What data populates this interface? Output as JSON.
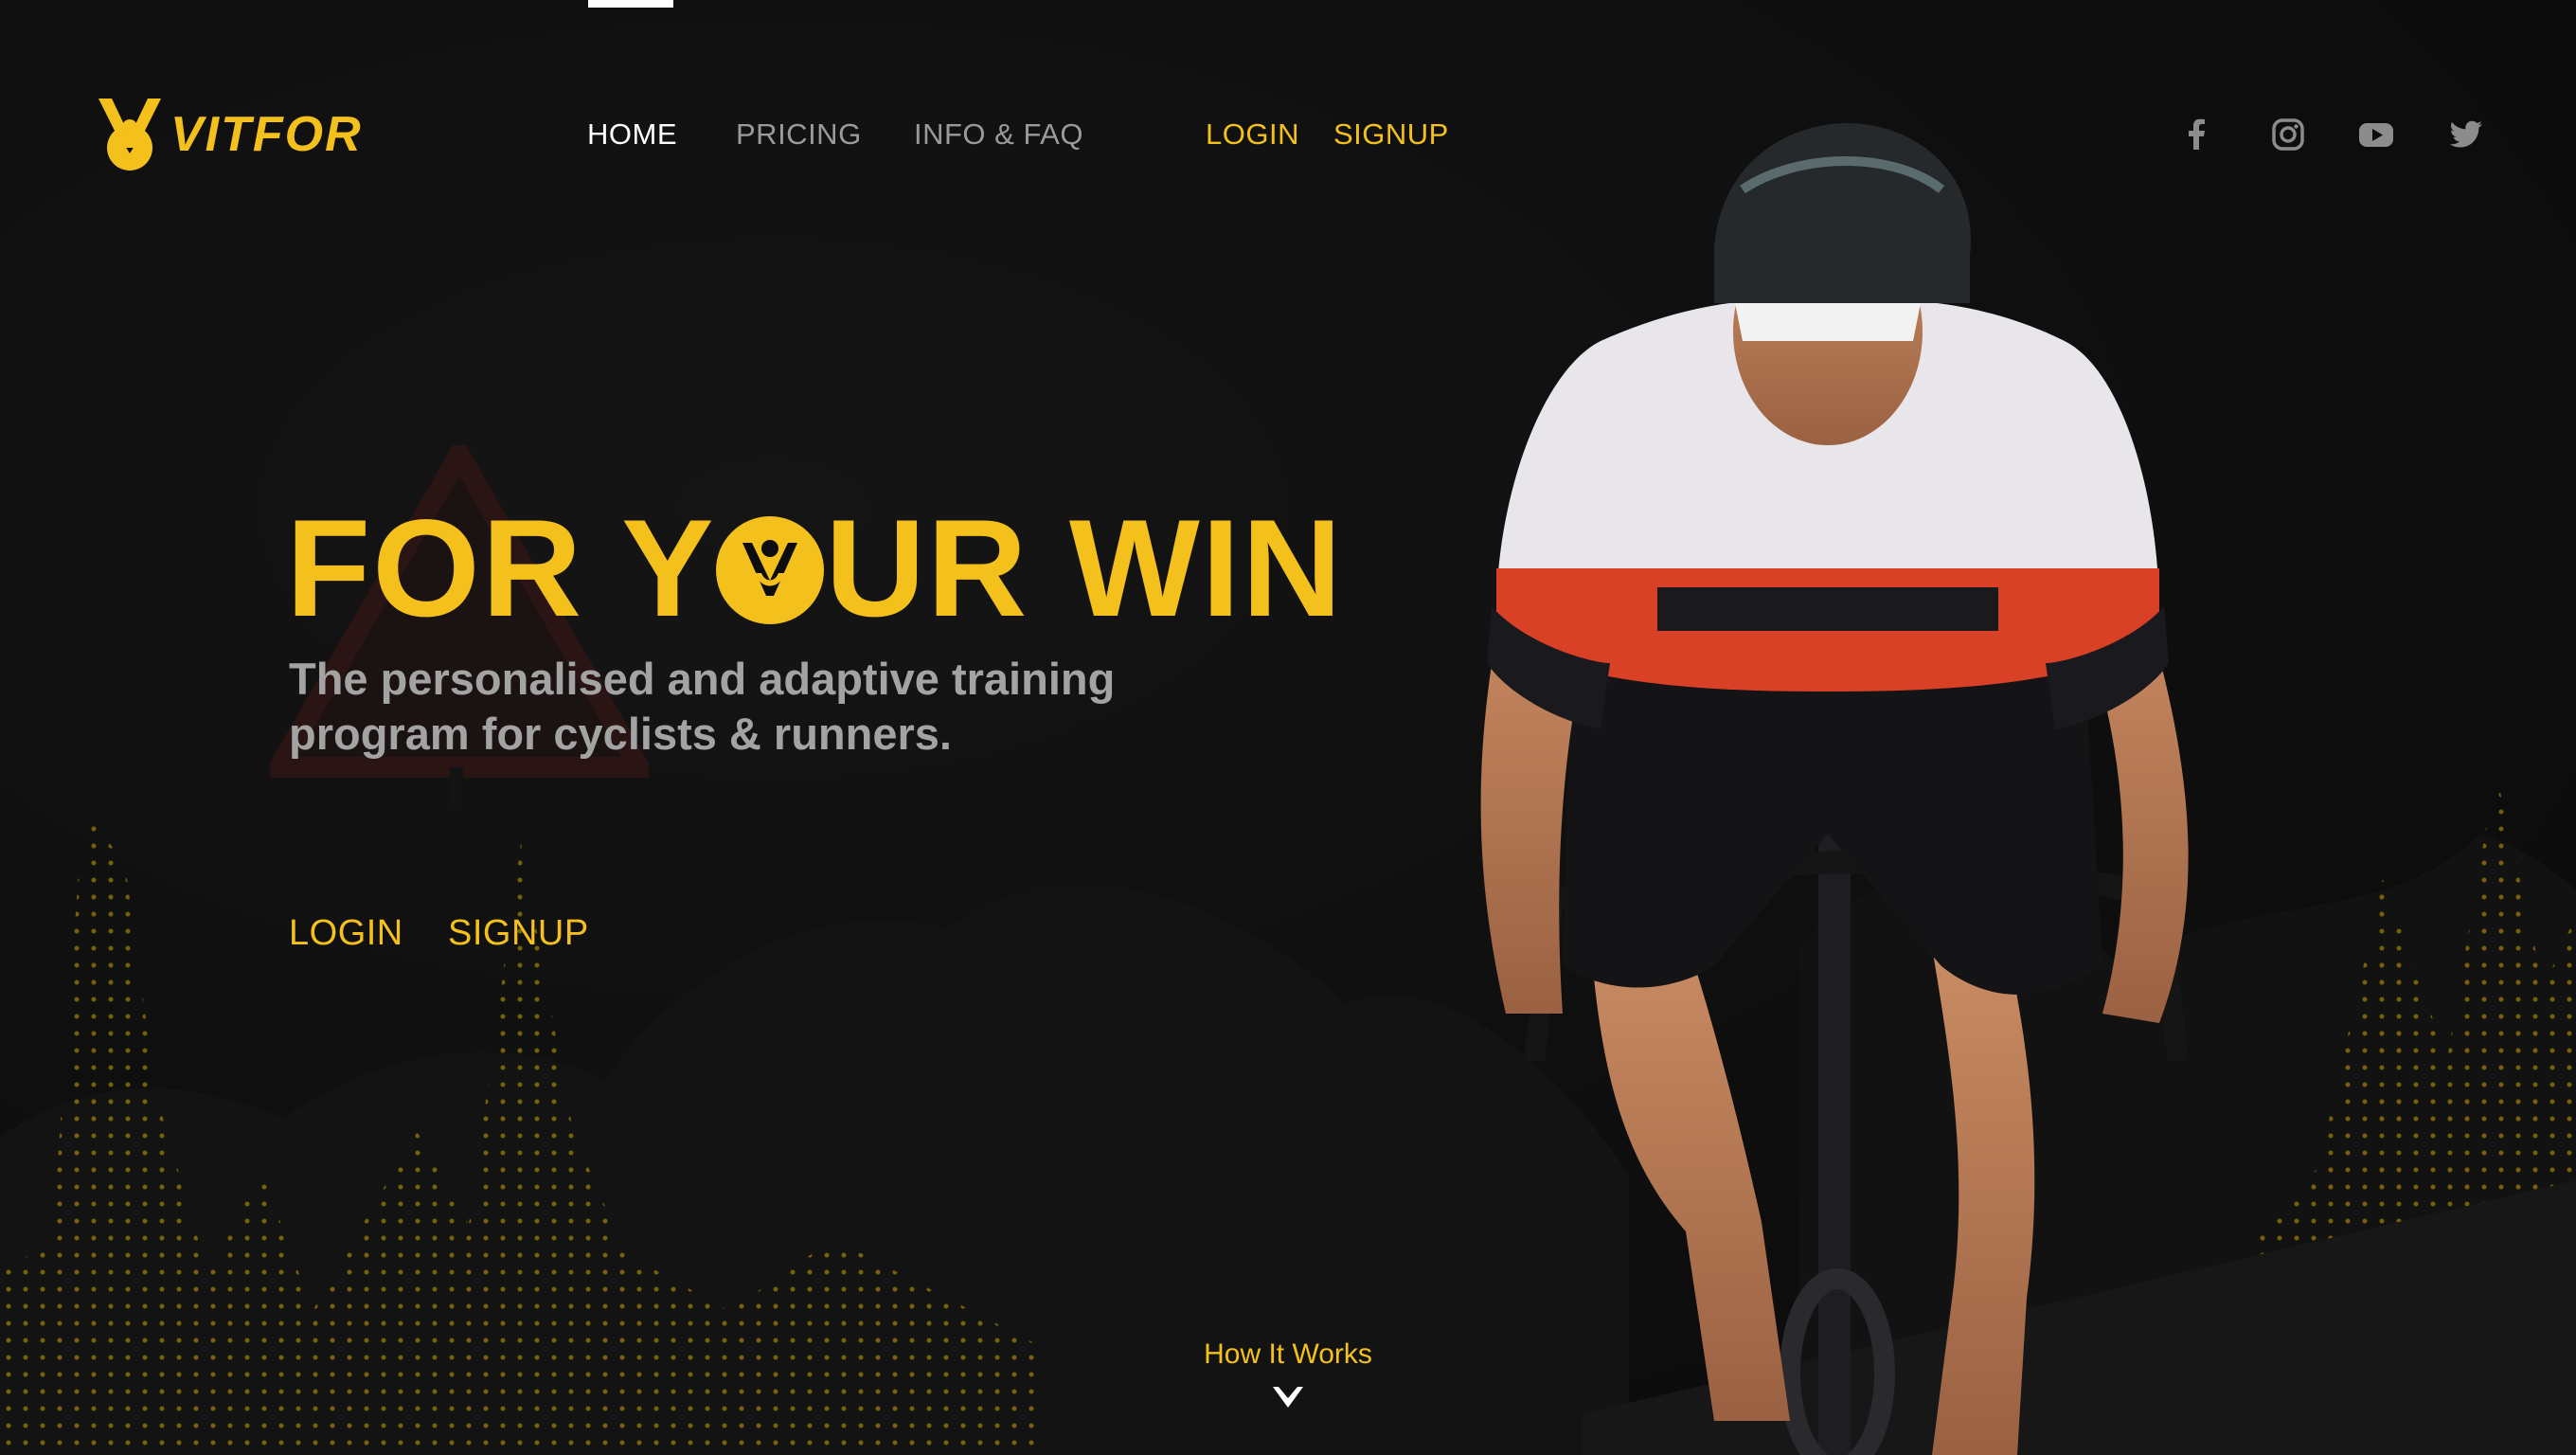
{
  "brand": {
    "name": "VITFOR",
    "color": "#f3c01c",
    "logo_icon": "vitfor-runner-logo-icon"
  },
  "nav": {
    "items": [
      {
        "label": "HOME",
        "active": true
      },
      {
        "label": "PRICING",
        "active": false
      },
      {
        "label": "INFO & FAQ",
        "active": false
      }
    ],
    "login_label": "LOGIN",
    "signup_label": "SIGNUP"
  },
  "social": [
    "facebook-icon",
    "instagram-icon",
    "youtube-icon",
    "twitter-icon"
  ],
  "hero": {
    "title_part1": "FOR Y",
    "title_part2": "UR WIN",
    "subtitle_line1": "The personalised and adaptive training",
    "subtitle_line2": "program for cyclists & runners.",
    "login_label": "LOGIN",
    "signup_label": "SIGNUP"
  },
  "how_it_works": {
    "label": "How It Works",
    "icon": "chevron-down-icon"
  },
  "colors": {
    "accent": "#f3c01c",
    "background": "#0d0d0d",
    "muted_text": "#a3a3a3",
    "nav_inactive": "#9a9a9a"
  }
}
